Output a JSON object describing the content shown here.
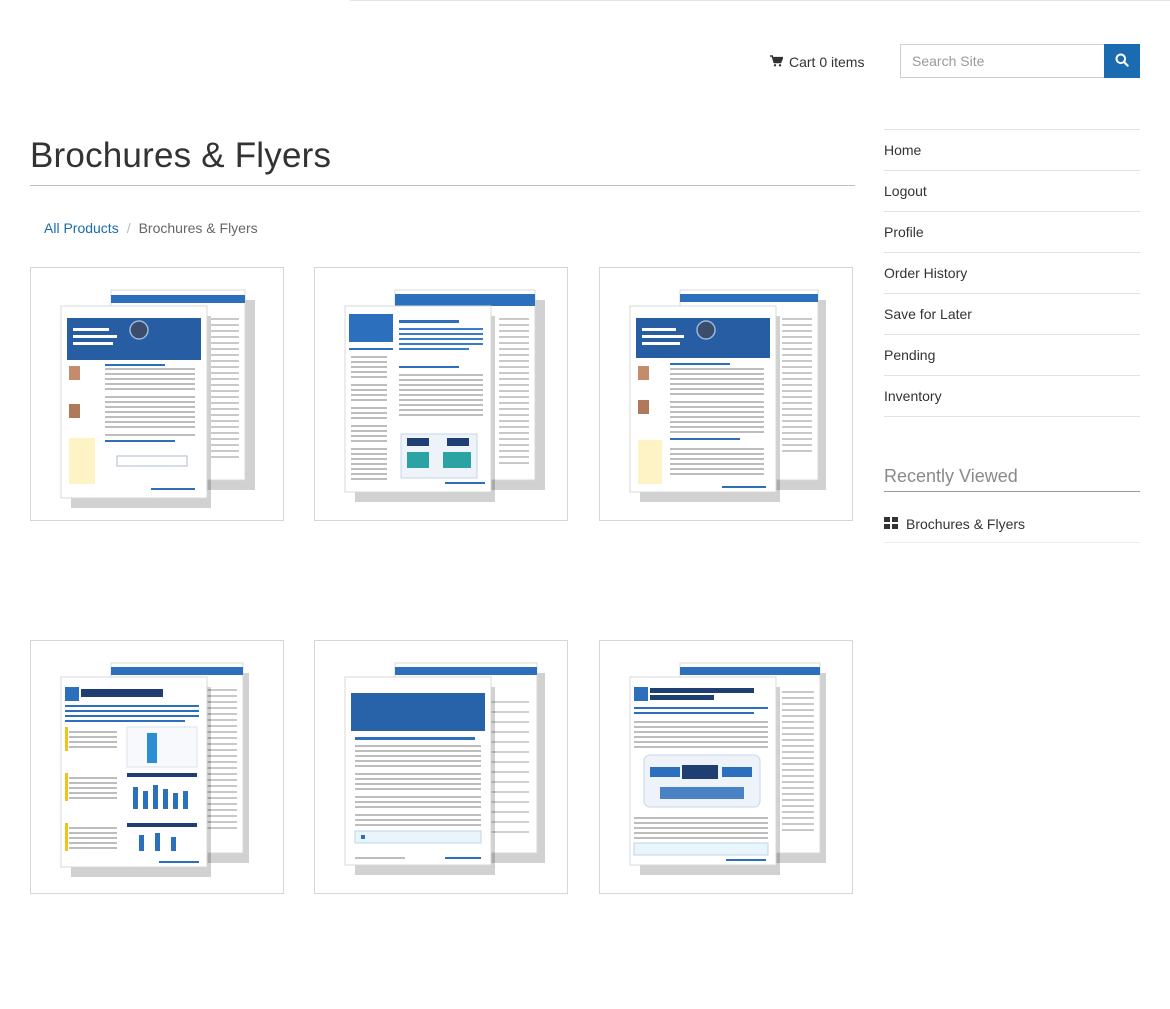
{
  "header": {
    "cart_label": "Cart 0 items",
    "search_placeholder": "Search Site"
  },
  "page": {
    "title": "Brochures & Flyers"
  },
  "breadcrumb": {
    "root": "All Products",
    "current": "Brochures & Flyers"
  },
  "products": [
    {
      "thumbnail": "brochure-thumbnail-1"
    },
    {
      "thumbnail": "brochure-thumbnail-2"
    },
    {
      "thumbnail": "brochure-thumbnail-3"
    },
    {
      "thumbnail": "brochure-thumbnail-4"
    },
    {
      "thumbnail": "brochure-thumbnail-5"
    },
    {
      "thumbnail": "brochure-thumbnail-6"
    }
  ],
  "sidebar": {
    "items": [
      {
        "label": "Home"
      },
      {
        "label": "Logout"
      },
      {
        "label": "Profile"
      },
      {
        "label": "Order History"
      },
      {
        "label": "Save for Later"
      },
      {
        "label": "Pending"
      },
      {
        "label": "Inventory"
      }
    ],
    "recently_viewed_title": "Recently Viewed",
    "recently_viewed": [
      {
        "label": "Brochures & Flyers",
        "icon": "grid-icon"
      }
    ]
  },
  "colors": {
    "accent": "#1a6bb0",
    "doc_blue": "#2b6fbd",
    "doc_dark": "#1f3f73"
  }
}
